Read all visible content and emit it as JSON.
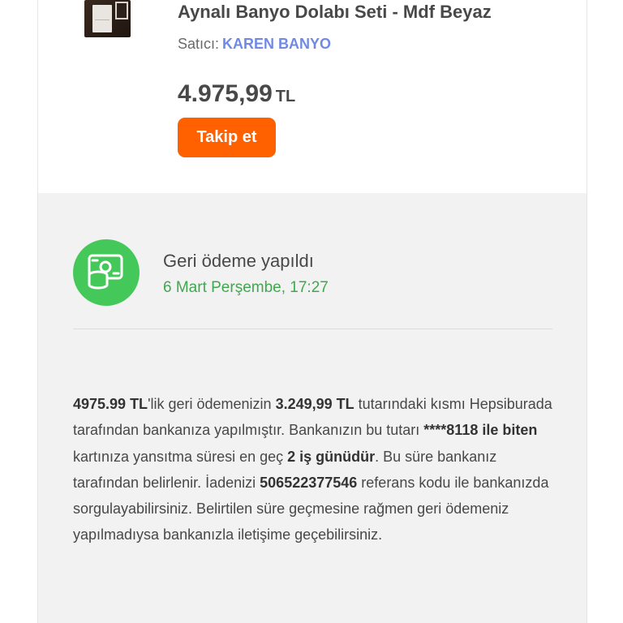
{
  "product": {
    "title": "Aynalı Banyo Dolabı Seti - Mdf Beyaz",
    "seller_label": "Satıcı:",
    "seller_name": "KAREN BANYO",
    "price": "4.975,99",
    "currency": "TL",
    "follow_button": "Takip et"
  },
  "refund": {
    "status_title": "Geri ödeme yapıldı",
    "status_date": "6 Mart Perşembe, 17:27",
    "icon": "cash-refund-icon",
    "message": {
      "total_amount": "4975.99 TL",
      "part1": "'lik geri ödemenizin ",
      "refunded_amount": "3.249,99 TL",
      "part2": " tutarındaki kısmı Hepsiburada tarafından bankanıza yapılmıştır. Bankanızın bu tutarı ",
      "card": "****8118 ile biten",
      "part3": " kartınıza yansıtma süresi en geç ",
      "duration": "2 iş günüdür",
      "part4": ". Bu süre bankanız tarafından belirlenir. İadenizi ",
      "reference": "506522377546",
      "part5": " referans kodu ile bankanızda sorgulayabilirsiniz. Belirtilen süre geçmesine rağmen geri ödemeniz yapılmadıysa bankanızla iletişime geçebilirsiniz."
    }
  },
  "colors": {
    "accent_orange": "#ff6000",
    "seller_blue": "#6f8ae6",
    "success_green": "#45c85a",
    "date_green": "#3fa84f",
    "panel_gray": "#f2f2f2"
  }
}
